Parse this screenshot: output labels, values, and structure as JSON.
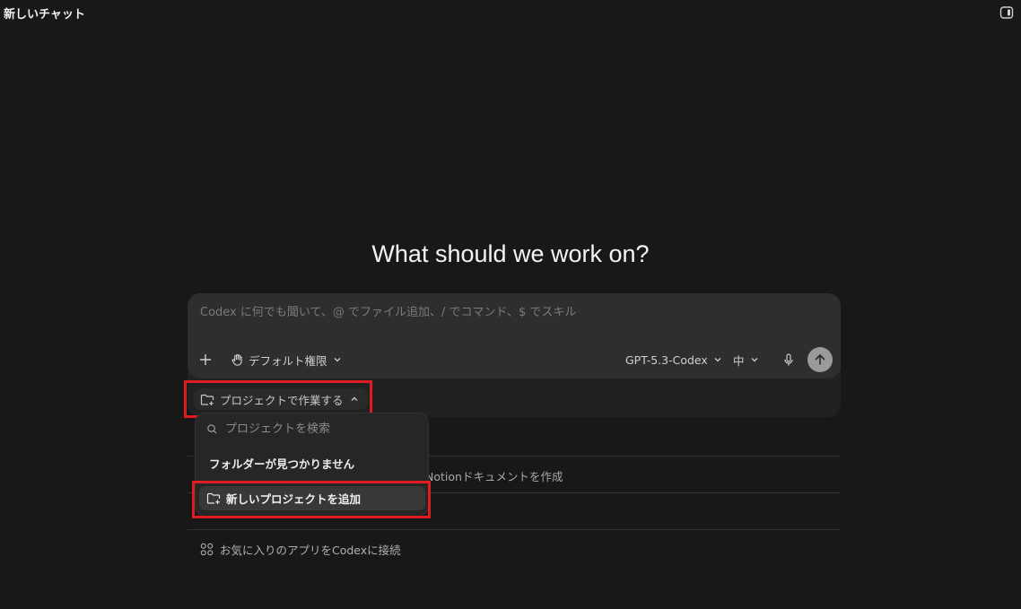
{
  "window": {
    "title": "新しいチャット"
  },
  "main": {
    "heading": "What should we work on?"
  },
  "composer": {
    "placeholder": "Codex に何でも聞いて、@ でファイル追加、/ でコマンド、$ でスキル",
    "value": "",
    "permission_label": "デフォルト権限",
    "model_label": "GPT-5.3-Codex",
    "effort_label": "中"
  },
  "project": {
    "label": "プロジェクトで作業する",
    "dropdown": {
      "search_placeholder": "プロジェクトを検索",
      "empty_text": "フォルダーが見つかりません",
      "add_label": "新しいプロジェクトを追加"
    }
  },
  "suggestions": {
    "notion_partial": "Notionドキュメントを作成",
    "connect_apps": "お気に入りのアプリをCodexに接続"
  },
  "colors": {
    "background": "#181818",
    "composer": "#2e2e2e",
    "highlight": "#e11b22"
  }
}
